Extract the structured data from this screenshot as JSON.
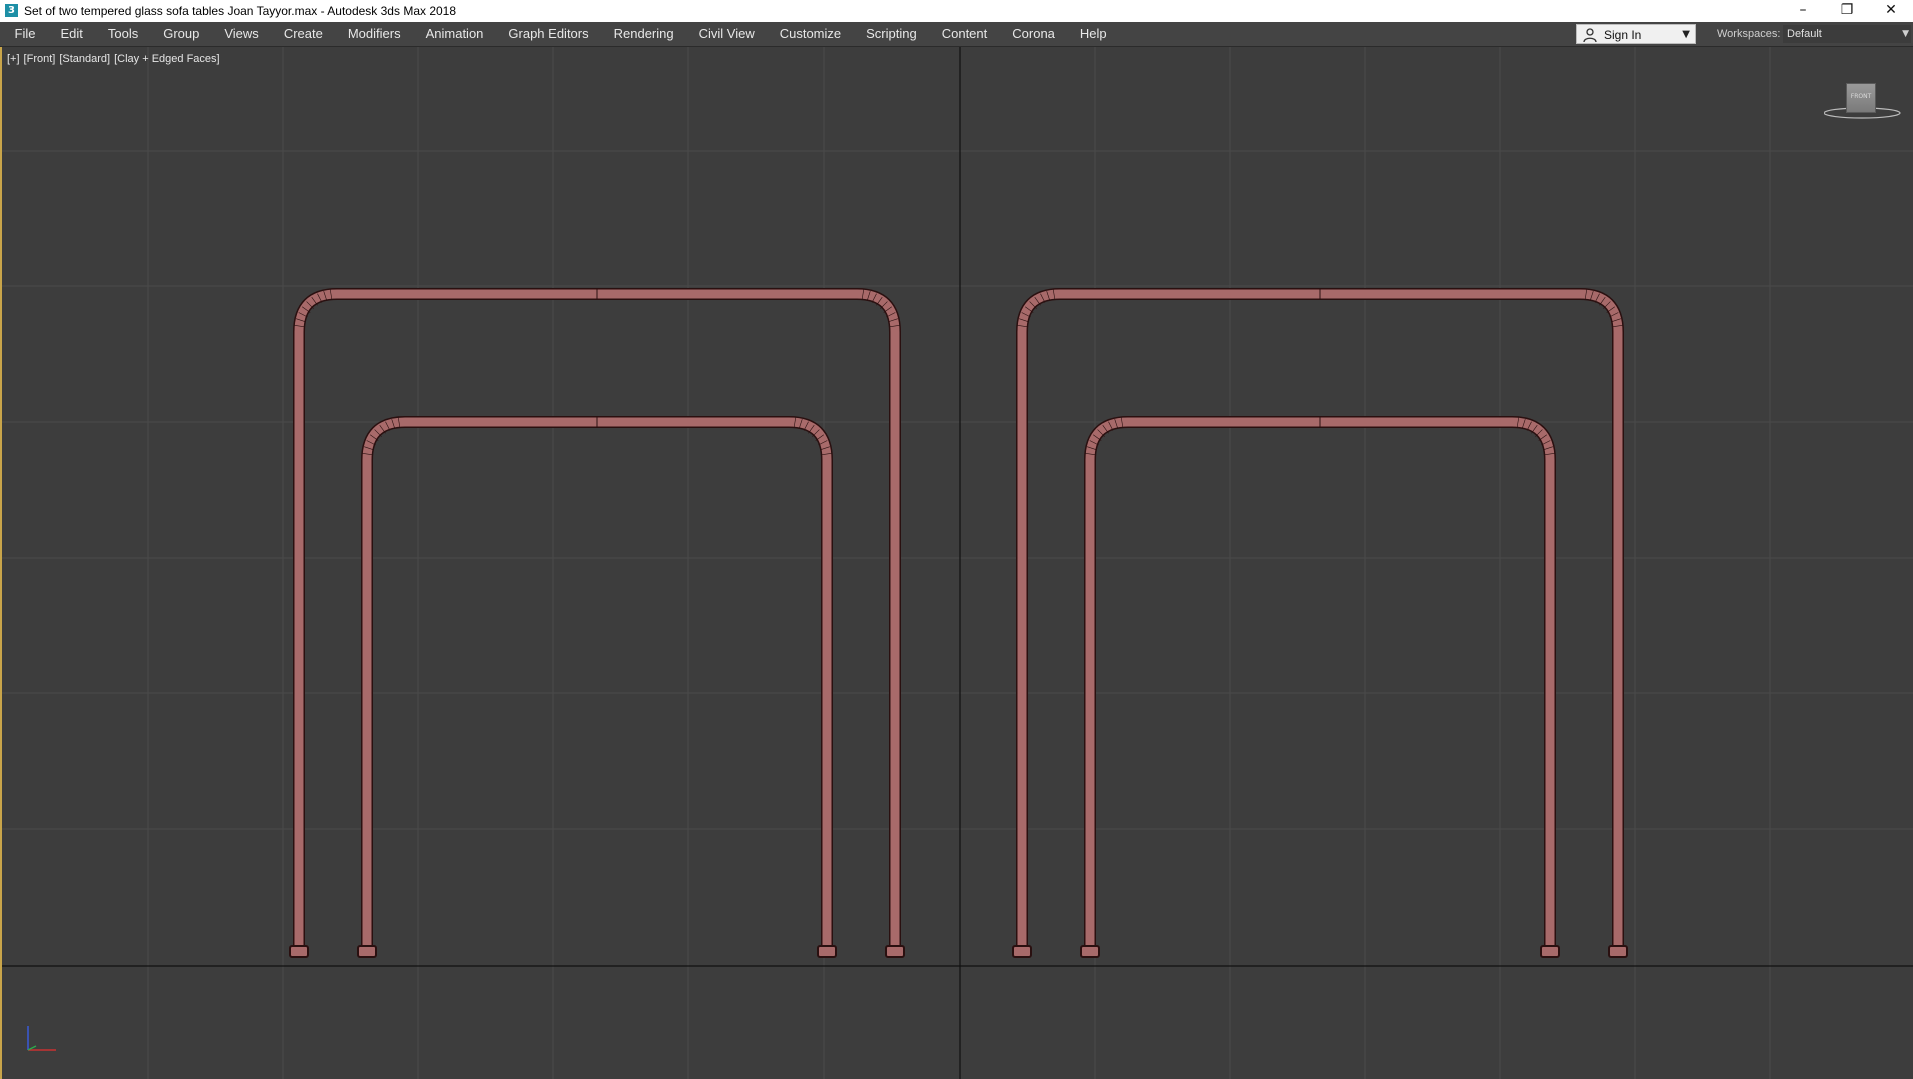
{
  "window": {
    "title": "Set of two tempered glass sofa tables Joan Tayyor.max - Autodesk 3ds Max 2018",
    "app_icon": "3ds-max-icon",
    "controls": {
      "minimize": "–",
      "restore": "❐",
      "close": "✕"
    }
  },
  "menubar": {
    "items": [
      "File",
      "Edit",
      "Tools",
      "Group",
      "Views",
      "Create",
      "Modifiers",
      "Animation",
      "Graph Editors",
      "Rendering",
      "Civil View",
      "Customize",
      "Scripting",
      "Content",
      "Corona",
      "Help"
    ]
  },
  "account": {
    "sign_in_label": "Sign In"
  },
  "workspaces": {
    "label": "Workspaces:",
    "value": "Default"
  },
  "viewport": {
    "label": {
      "menu": "[+]",
      "view": "[Front]",
      "shading_style": "[Standard]",
      "shading": "[Clay + Edged Faces]"
    },
    "viewcube_face": "FRONT",
    "colors": {
      "background": "#3d3d3d",
      "grid": "#4a4a4a",
      "axis": "#111111",
      "tube_fill": "#a86a6a",
      "tube_edge": "#2a1010",
      "active_border": "#c9a54a"
    }
  },
  "axis_tripod": {
    "x": "x-axis",
    "y": "y-axis",
    "z": "z-axis"
  }
}
